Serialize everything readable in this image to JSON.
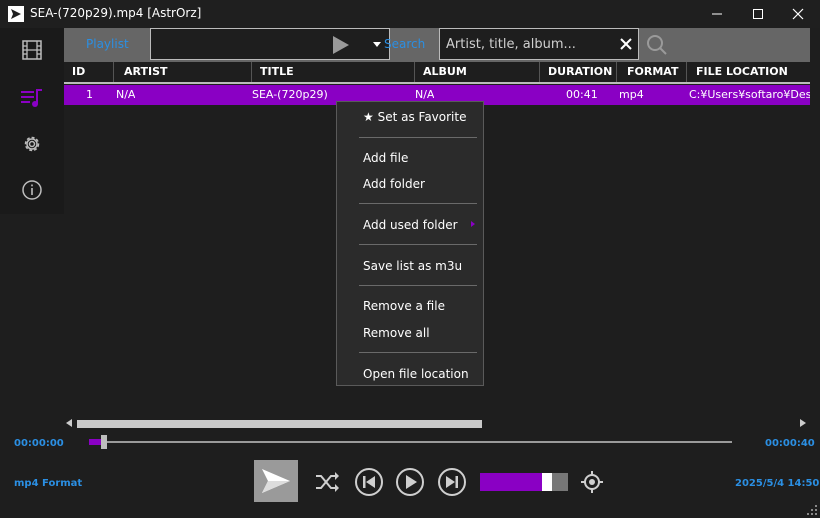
{
  "window": {
    "title": "SEA-(720p29).mp4 [AstrOrz]",
    "controls": [
      "minimize-icon",
      "maximize-icon",
      "close-icon"
    ]
  },
  "sidebar": {
    "items": [
      {
        "name": "video",
        "icon": "film-icon"
      },
      {
        "name": "playlist",
        "icon": "playlist-icon",
        "active": true
      },
      {
        "name": "settings",
        "icon": "gear-icon"
      },
      {
        "name": "about",
        "icon": "info-icon"
      }
    ]
  },
  "toolbar": {
    "playlist_label": "Playlist",
    "playlist_value": "",
    "search_label": "Search",
    "search_value": "",
    "search_placeholder": "Artist, title, album..."
  },
  "table": {
    "columns": [
      "ID",
      "ARTIST",
      "TITLE",
      "ALBUM",
      "DURATION",
      "FORMAT",
      "FILE LOCATION"
    ],
    "rows": [
      {
        "id": "1",
        "artist": "N/A",
        "title": "SEA-(720p29)",
        "album": "N/A",
        "duration": "00:41",
        "format": "mp4",
        "location": "C:¥Users¥softaro¥Desktop"
      }
    ]
  },
  "context_menu": {
    "favorite": "★ Set as Favorite",
    "add_file": "Add file",
    "add_folder": "Add folder",
    "add_used_folder": "Add used folder",
    "save_m3u": "Save list as m3u",
    "remove_file": "Remove a file",
    "remove_all": "Remove all",
    "open_location": "Open file location"
  },
  "player": {
    "current_time": "00:00:00",
    "total_time": "00:00:40",
    "seek_fraction": 0.02,
    "volume_fraction": 0.8,
    "format_label": "mp4 Format",
    "datetime": "2025/5/4 14:50"
  },
  "colors": {
    "accent": "#8a00c4",
    "link_blue": "#2b8fe3",
    "background": "#1e1e1e",
    "toolbar_gray": "#666666"
  }
}
